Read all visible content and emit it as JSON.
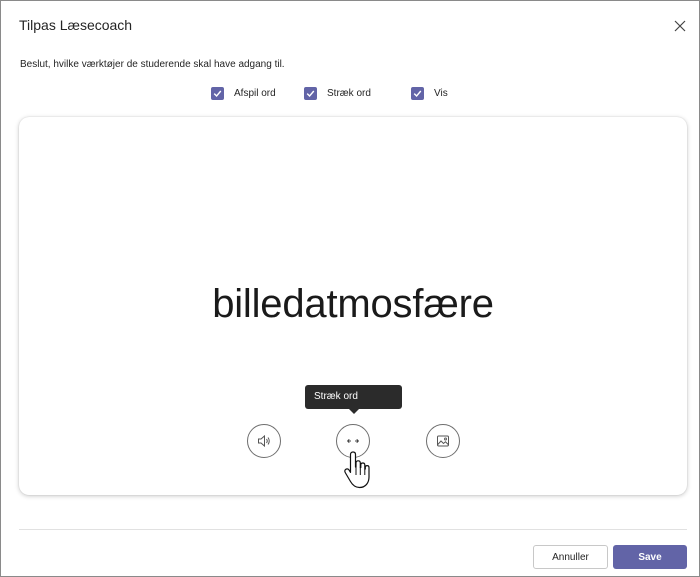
{
  "dialog": {
    "title": "Tilpas Læsecoach",
    "instruction": "Beslut, hvilke værktøjer de studerende skal have adgang til."
  },
  "options": [
    {
      "label": "Afspil ord",
      "checked": true
    },
    {
      "label": "Stræk ord",
      "checked": true
    },
    {
      "label": "Vis",
      "checked": true
    }
  ],
  "preview": {
    "word": "billedatmosfære",
    "tooltip": "Stræk ord",
    "tools": [
      "speaker-icon",
      "stretch-arrows-icon",
      "picture-icon"
    ]
  },
  "footer": {
    "cancel_label": "Annuller",
    "save_label": "Save"
  },
  "colors": {
    "accent": "#6264a7",
    "tooltip_bg": "#2b2b2b"
  }
}
